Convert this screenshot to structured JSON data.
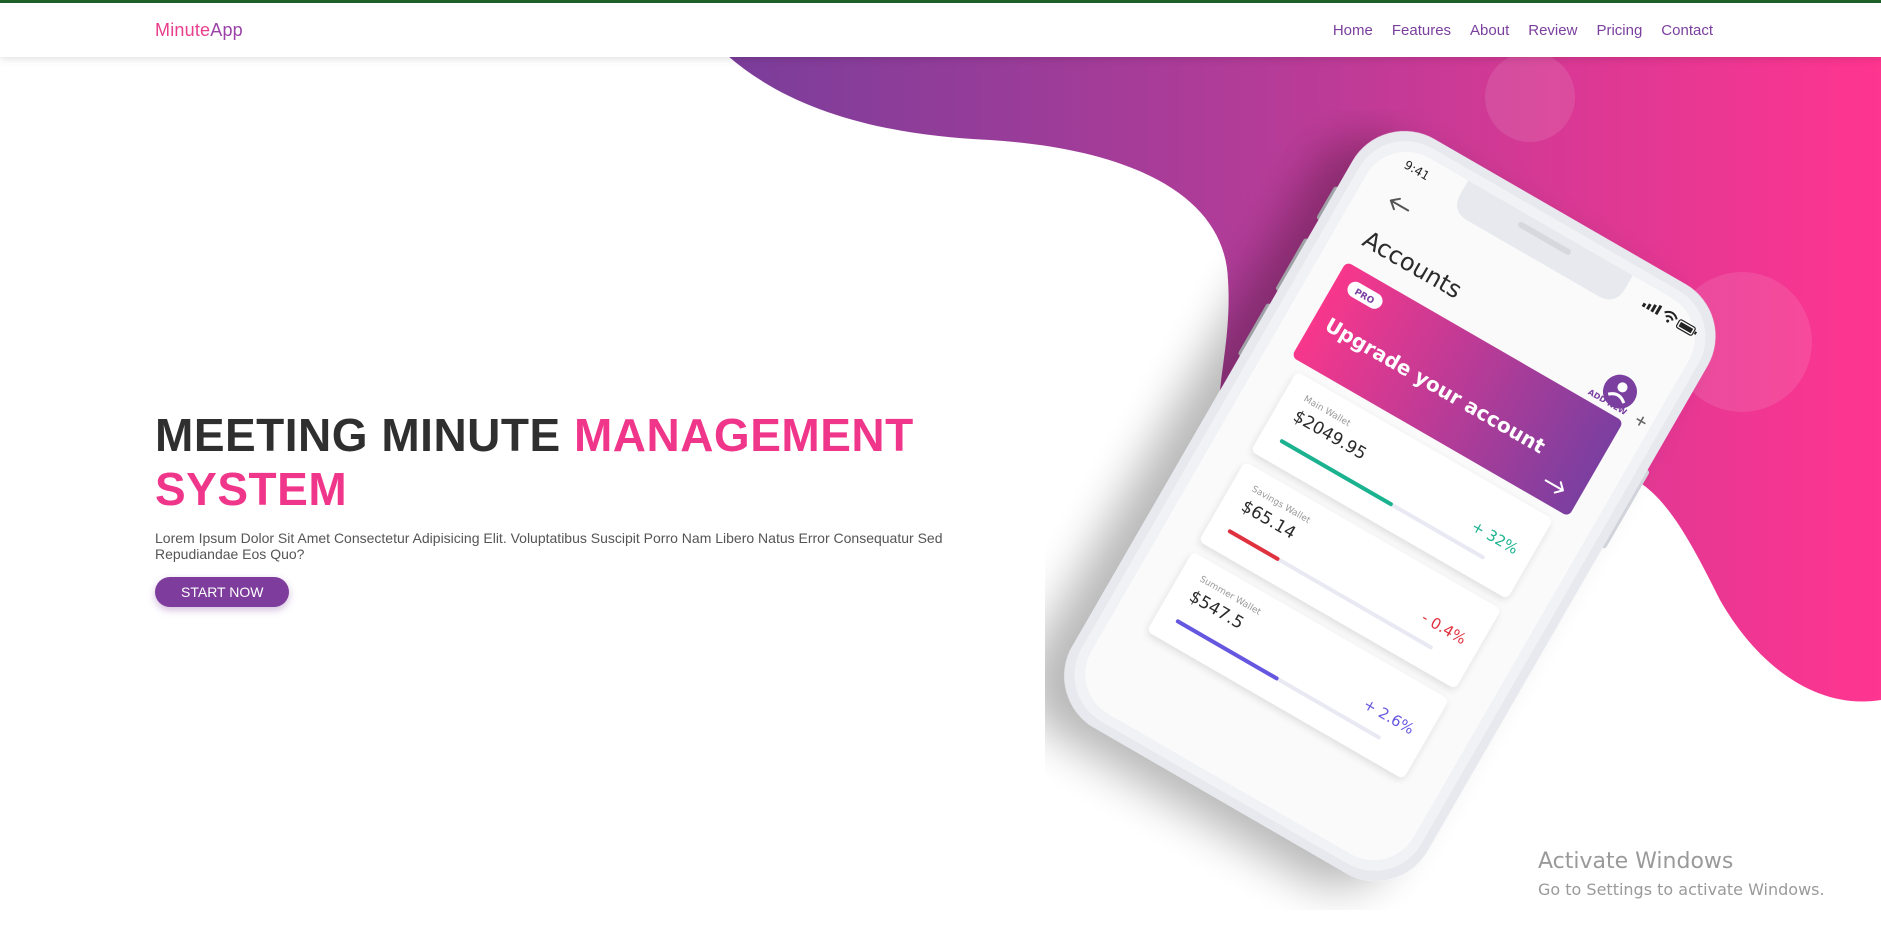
{
  "brand": {
    "part1": "Minute",
    "part2": "App"
  },
  "nav": {
    "home": "Home",
    "features": "Features",
    "about": "About",
    "review": "Review",
    "pricing": "Pricing",
    "contact": "Contact"
  },
  "hero": {
    "title_dark": "MEETING MINUTE ",
    "title_accent": "MANAGEMENT SYSTEM",
    "description": "Lorem Ipsum Dolor Sit Amet Consectetur Adipisicing Elit. Voluptatibus Suscipit Porro Nam Libero Natus Error Consequatur Sed Repudiandae Eos Quo?",
    "cta_label": "START NOW"
  },
  "phone": {
    "time": "9:41",
    "heading": "Accounts",
    "pro_badge": "PRO",
    "upgrade_text": "Upgrade your account",
    "add_new": "ADD NEW",
    "wallets": [
      {
        "name": "Main Wallet",
        "amount": "$2049.95",
        "change": "+ 32%",
        "color": "#1bb38f",
        "progress": 0.55
      },
      {
        "name": "Savings Wallet",
        "amount": "$65.14",
        "change": "- 0.4%",
        "color": "#e0313f",
        "progress": 0.25
      },
      {
        "name": "Summer Wallet",
        "amount": "$547.5",
        "change": "+ 2.6%",
        "color": "#6657e0",
        "progress": 0.5
      }
    ]
  },
  "watermark": {
    "title": "Activate Windows",
    "subtitle": "Go to Settings to activate Windows."
  },
  "colors": {
    "accent_pink": "#f0368a",
    "accent_purple": "#7e3d9c",
    "nav_link": "#7b3f9e",
    "topline": "#1e5f2a"
  }
}
